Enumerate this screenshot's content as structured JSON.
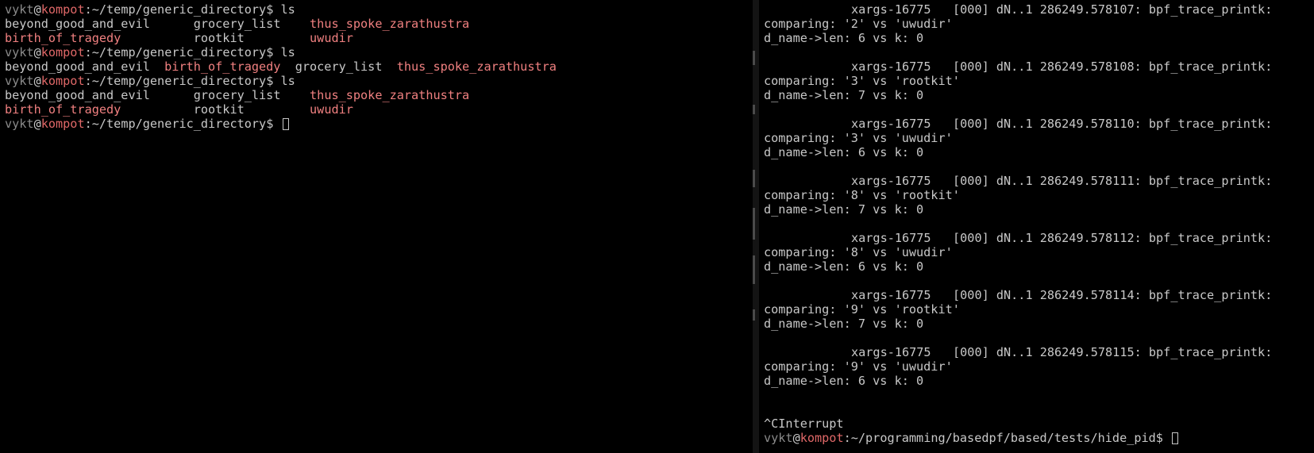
{
  "colors": {
    "background": "#000000",
    "text": "#c8c8c8",
    "user": "#8a8a8a",
    "host": "#e06868",
    "executable": "#f08080"
  },
  "left_terminal": {
    "prompt": {
      "user": "vykt",
      "at": "@",
      "host": "kompot",
      "path": ":~/temp/generic_directory$ "
    },
    "lines": [
      {
        "type": "prompt",
        "command": "ls"
      },
      {
        "type": "cols",
        "cells": [
          {
            "text": "beyond_good_and_evil",
            "exec": false,
            "w": 26
          },
          {
            "text": "grocery_list",
            "exec": false,
            "w": 16
          },
          {
            "text": "thus_spoke_zarathustra",
            "exec": true,
            "w": 0
          }
        ]
      },
      {
        "type": "cols",
        "cells": [
          {
            "text": "birth_of_tragedy",
            "exec": true,
            "w": 26
          },
          {
            "text": "rootkit",
            "exec": false,
            "w": 16
          },
          {
            "text": "uwudir",
            "exec": true,
            "w": 0
          }
        ]
      },
      {
        "type": "prompt",
        "command": "ls"
      },
      {
        "type": "cols",
        "cells": [
          {
            "text": "beyond_good_and_evil",
            "exec": false,
            "w": 22
          },
          {
            "text": "birth_of_tragedy",
            "exec": true,
            "w": 18
          },
          {
            "text": "grocery_list",
            "exec": false,
            "w": 14
          },
          {
            "text": "thus_spoke_zarathustra",
            "exec": true,
            "w": 0
          }
        ]
      },
      {
        "type": "prompt",
        "command": "ls"
      },
      {
        "type": "cols",
        "cells": [
          {
            "text": "beyond_good_and_evil",
            "exec": false,
            "w": 26
          },
          {
            "text": "grocery_list",
            "exec": false,
            "w": 16
          },
          {
            "text": "thus_spoke_zarathustra",
            "exec": true,
            "w": 0
          }
        ]
      },
      {
        "type": "cols",
        "cells": [
          {
            "text": "birth_of_tragedy",
            "exec": true,
            "w": 26
          },
          {
            "text": "rootkit",
            "exec": false,
            "w": 16
          },
          {
            "text": "uwudir",
            "exec": true,
            "w": 0
          }
        ]
      },
      {
        "type": "prompt",
        "command": "",
        "cursor": true
      }
    ]
  },
  "right_terminal": {
    "prompt": {
      "user": "vykt",
      "at": "@",
      "host": "kompot",
      "path": ":~/programming/basedpf/based/tests/hide_pid$ "
    },
    "lines": [
      {
        "type": "trace",
        "text": "xargs-16775   [000] dN..1 286249.578107: bpf_trace_printk:"
      },
      {
        "type": "text",
        "text": "comparing: '2' vs 'uwudir'"
      },
      {
        "type": "text",
        "text": "d_name->len: 6 vs k: 0"
      },
      {
        "type": "blank"
      },
      {
        "type": "trace",
        "text": "xargs-16775   [000] dN..1 286249.578108: bpf_trace_printk:"
      },
      {
        "type": "text",
        "text": "comparing: '3' vs 'rootkit'"
      },
      {
        "type": "text",
        "text": "d_name->len: 7 vs k: 0"
      },
      {
        "type": "blank"
      },
      {
        "type": "trace",
        "text": "xargs-16775   [000] dN..1 286249.578110: bpf_trace_printk:"
      },
      {
        "type": "text",
        "text": "comparing: '3' vs 'uwudir'"
      },
      {
        "type": "text",
        "text": "d_name->len: 6 vs k: 0"
      },
      {
        "type": "blank"
      },
      {
        "type": "trace",
        "text": "xargs-16775   [000] dN..1 286249.578111: bpf_trace_printk:"
      },
      {
        "type": "text",
        "text": "comparing: '8' vs 'rootkit'"
      },
      {
        "type": "text",
        "text": "d_name->len: 7 vs k: 0"
      },
      {
        "type": "blank"
      },
      {
        "type": "trace",
        "text": "xargs-16775   [000] dN..1 286249.578112: bpf_trace_printk:"
      },
      {
        "type": "text",
        "text": "comparing: '8' vs 'uwudir'"
      },
      {
        "type": "text",
        "text": "d_name->len: 6 vs k: 0"
      },
      {
        "type": "blank"
      },
      {
        "type": "trace",
        "text": "xargs-16775   [000] dN..1 286249.578114: bpf_trace_printk:"
      },
      {
        "type": "text",
        "text": "comparing: '9' vs 'rootkit'"
      },
      {
        "type": "text",
        "text": "d_name->len: 7 vs k: 0"
      },
      {
        "type": "blank"
      },
      {
        "type": "trace",
        "text": "xargs-16775   [000] dN..1 286249.578115: bpf_trace_printk:"
      },
      {
        "type": "text",
        "text": "comparing: '9' vs 'uwudir'"
      },
      {
        "type": "text",
        "text": "d_name->len: 6 vs k: 0"
      },
      {
        "type": "blank"
      },
      {
        "type": "blank"
      },
      {
        "type": "text",
        "text": "^CInterrupt"
      },
      {
        "type": "prompt",
        "command": "",
        "cursor": true
      }
    ]
  }
}
